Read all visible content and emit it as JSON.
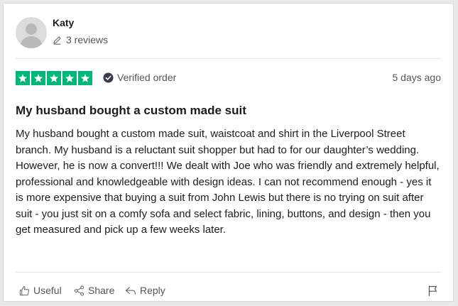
{
  "review": {
    "author": {
      "name": "Katy",
      "reviews_count": "3 reviews",
      "avatar_icon": "user-placeholder-icon"
    },
    "rating": {
      "stars": 5,
      "max": 5,
      "color": "#00b67a"
    },
    "verified_label": "Verified order",
    "date": "5 days ago",
    "title": "My husband bought a custom made suit",
    "body": "My husband bought a custom made suit, waistcoat and shirt in the Liverpool Street branch. My husband is a reluctant suit shopper but had to for our daughter’s wedding. However, he is now a convert!!! We dealt with Joe who was friendly and extremely helpful, professional and knowledgeable with design ideas. I can not recommend enough - yes it is more expensive that buying a suit from John Lewis but there is no trying on suit after suit - you just sit on a comfy sofa and select fabric, lining, buttons, and design - then you get measured and pick up a few weeks later."
  },
  "actions": {
    "useful": "Useful",
    "share": "Share",
    "reply": "Reply",
    "flag_icon": "flag-icon"
  }
}
